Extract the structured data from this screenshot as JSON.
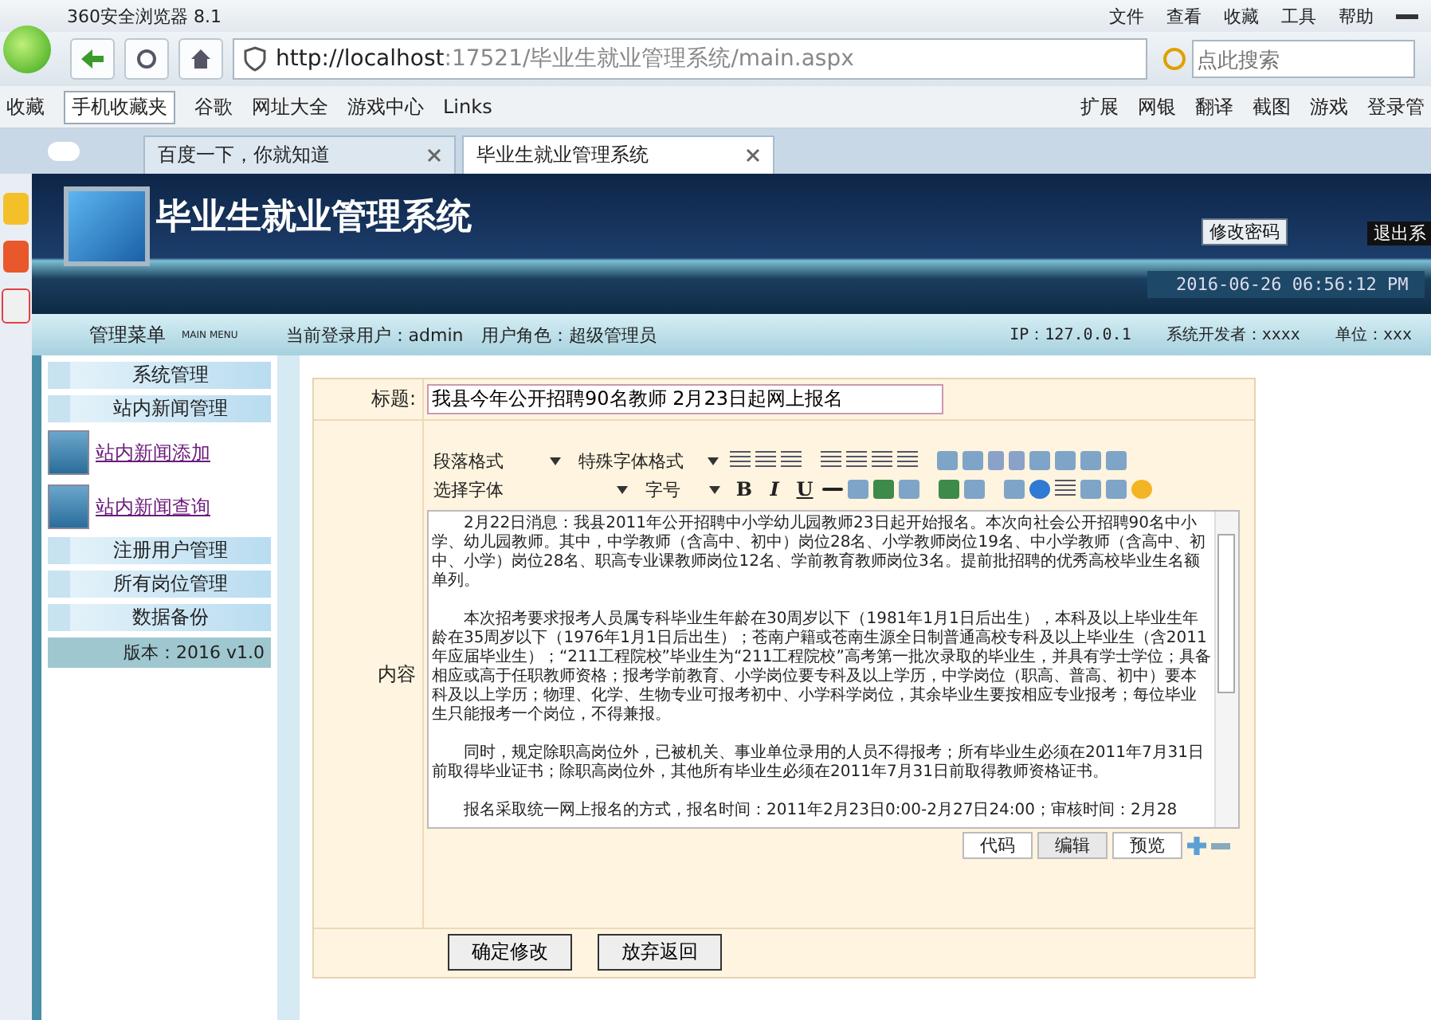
{
  "browser": {
    "title": "360安全浏览器 8.1",
    "menu": [
      "文件",
      "查看",
      "收藏",
      "工具",
      "帮助"
    ],
    "url_host": "http://localhost",
    "url_rest": ":17521/毕业生就业管理系统/main.aspx",
    "search": {
      "placeholder": "点此搜索"
    },
    "bookmarks": [
      "收藏",
      "手机收藏夹",
      "谷歌",
      "网址大全",
      "游戏中心",
      "Links"
    ],
    "tools": [
      "扩展",
      "网银",
      "翻译",
      "截图",
      "游戏",
      "登录管"
    ],
    "tabs": [
      {
        "label": "百度一下，你就知道",
        "selected": false
      },
      {
        "label": "毕业生就业管理系统",
        "selected": true
      }
    ]
  },
  "header": {
    "title": "毕业生就业管理系统",
    "change_password": "修改密码",
    "logout": "退出系",
    "datetime": "2016-06-26 06:56:12 PM"
  },
  "info_bar": {
    "menu_title": "管理菜单",
    "menu_subtitle": "MAIN MENU",
    "user": "当前登录用户：admin　用户角色：超级管理员",
    "items": [
      "IP：127.0.0.1",
      "系统开发者：xxxx",
      "单位：xxx"
    ]
  },
  "sidebar": {
    "items": [
      {
        "label": "系统管理",
        "kind": "header"
      },
      {
        "label": "站内新闻管理",
        "kind": "header"
      },
      {
        "label": "站内新闻添加",
        "kind": "link"
      },
      {
        "label": "站内新闻查询",
        "kind": "link"
      },
      {
        "label": "注册用户管理",
        "kind": "header"
      },
      {
        "label": "所有岗位管理",
        "kind": "header"
      },
      {
        "label": "数据备份",
        "kind": "header"
      }
    ],
    "version": "版本：2016 v1.0"
  },
  "form": {
    "title_label": "标题:",
    "title_value": "我县今年公开招聘90名教师 2月23日起网上报名",
    "content_label": "内容",
    "editor": {
      "selects": [
        "段落格式",
        "特殊字体格式",
        "选择字体",
        "字号"
      ],
      "format_buttons": [
        "B",
        "I",
        "U"
      ],
      "paragraphs": [
        "2月22日消息：我县2011年公开招聘中小学幼儿园教师23日起开始报名。本次向社会公开招聘90名中小学、幼儿园教师。其中，中学教师（含高中、初中）岗位28名、小学教师岗位19名、中小学教师（含高中、初中、小学）岗位28名、职高专业课教师岗位12名、学前教育教师岗位3名。提前批招聘的优秀高校毕业生名额单列。",
        "本次招考要求报考人员属专科毕业生年龄在30周岁以下（1981年1月1日后出生），本科及以上毕业生年龄在35周岁以下（1976年1月1日后出生）；苍南户籍或苍南生源全日制普通高校专科及以上毕业生（含2011年应届毕业生）；“211工程院校”毕业生为“211工程院校”高考第一批次录取的毕业生，并具有学士学位；具备相应或高于任职教师资格；报考学前教育、小学岗位要专科及以上学历，中学岗位（职高、普高、初中）要本科及以上学历；物理、化学、生物专业可报考初中、小学科学岗位，其余毕业生要按相应专业报考；每位毕业生只能报考一个岗位，不得兼报。",
        "同时，规定除职高岗位外，已被机关、事业单位录用的人员不得报考；所有毕业生必须在2011年7月31日前取得毕业证书；除职高岗位外，其他所有毕业生必须在2011年7月31日前取得教师资格证书。",
        "报名采取统一网上报名的方式，报名时间：2011年2月23日0:00-2月27日24:00；审核时间：2月28"
      ],
      "modes": [
        {
          "label": "代码",
          "selected": false
        },
        {
          "label": "编辑",
          "selected": true
        },
        {
          "label": "预览",
          "selected": false
        }
      ]
    },
    "buttons": [
      "确定修改",
      "放弃返回"
    ]
  }
}
